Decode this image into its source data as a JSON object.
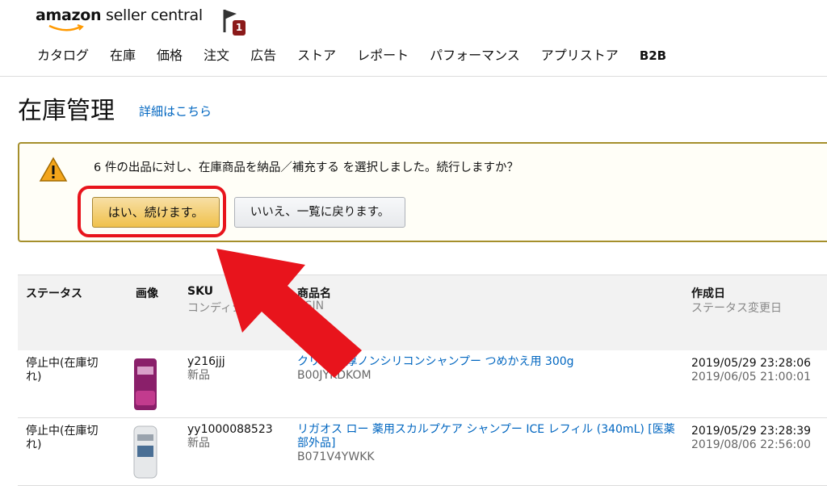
{
  "header": {
    "logo_brand": "amazon",
    "logo_rest": " seller central",
    "notification_count": "1",
    "nav": [
      "カタログ",
      "在庫",
      "価格",
      "注文",
      "広告",
      "ストア",
      "レポート",
      "パフォーマンス",
      "アプリストア",
      "B2B"
    ]
  },
  "page": {
    "title": "在庫管理",
    "details_link": "詳細はこちら"
  },
  "alert": {
    "message": "6 件の出品に対し、在庫商品を納品／補充する を選択しました。続行しますか？",
    "yes_button": "はい、続けます。",
    "no_button": "いいえ、一覧に戻ります。"
  },
  "table": {
    "headers": {
      "status": "ステータス",
      "image": "画像",
      "sku": "SKU",
      "sku_sub": "コンディション",
      "name": "商品名",
      "name_sub": "ASIN",
      "created": "作成日",
      "created_sub": "ステータス変更日"
    },
    "rows": [
      {
        "status": "停止中(在庫切れ)",
        "sku": "y216jjj",
        "condition": "新品",
        "name": "クリア 濃厚ノンシリコンシャンプー つめかえ用 300g",
        "asin": "B00JYKDKOM",
        "created": "2019/05/29 23:28:06",
        "changed": "2019/06/05 21:00:01"
      },
      {
        "status": "停止中(在庫切れ)",
        "sku": "yy1000088523",
        "condition": "新品",
        "name": "リガオス ロー 薬用スカルプケア シャンプー ICE レフィル (340mL) [医薬部外品]",
        "asin": "B071V4YWKK",
        "created": "2019/05/29 23:28:39",
        "changed": "2019/08/06 22:56:00"
      }
    ]
  },
  "colors": {
    "accent": "#0066c0",
    "alert_border": "#a58f2c",
    "primary_button": "#f0c14b",
    "annotation": "#e8141c"
  }
}
